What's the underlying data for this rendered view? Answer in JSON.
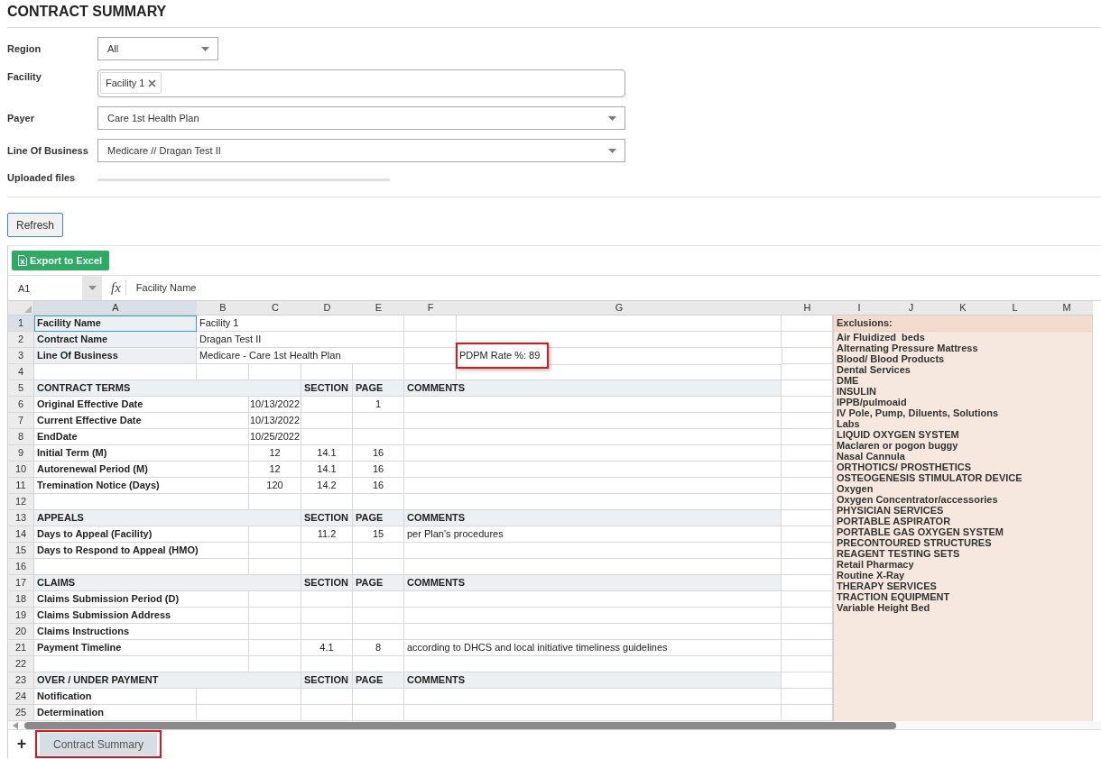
{
  "page_title": "CONTRACT SUMMARY",
  "filters": {
    "region": {
      "label": "Region",
      "value": "All"
    },
    "facility": {
      "label": "Facility",
      "chips": [
        {
          "label": "Facility 1"
        }
      ]
    },
    "payer": {
      "label": "Payer",
      "value": "Care 1st Health Plan"
    },
    "line_of_business": {
      "label": "Line Of Business",
      "value": "Medicare // Dragan Test II"
    },
    "uploaded_files": {
      "label": "Uploaded files"
    }
  },
  "refresh_button": "Refresh",
  "spreadsheet": {
    "export_button": "Export to Excel",
    "name_box": "A1",
    "function_label": "fx",
    "formula": "Facility Name",
    "columns": [
      {
        "label": "A",
        "selected": true
      },
      {
        "label": "B",
        "selected": false
      },
      {
        "label": "C",
        "selected": false
      },
      {
        "label": "D",
        "selected": false
      },
      {
        "label": "E",
        "selected": false
      },
      {
        "label": "F",
        "selected": false
      },
      {
        "label": "G",
        "selected": false
      },
      {
        "label": "H",
        "selected": false
      },
      {
        "label": "I",
        "selected": false
      },
      {
        "label": "J",
        "selected": false
      },
      {
        "label": "K",
        "selected": false
      },
      {
        "label": "L",
        "selected": false
      },
      {
        "label": "M",
        "selected": false
      }
    ],
    "rows": [
      {
        "number": "1",
        "selected": true,
        "kind": "info",
        "label": "Facility Name",
        "value": "Facility 1"
      },
      {
        "number": "2",
        "selected": false,
        "kind": "info",
        "label": "Contract Name",
        "value": "Dragan Test II"
      },
      {
        "number": "3",
        "selected": false,
        "kind": "info",
        "label": "Line Of Business",
        "value": "Medicare - Care 1st Health Plan",
        "note": "PDPM Rate %: 89",
        "note_highlighted": true
      },
      {
        "number": "4",
        "selected": false,
        "kind": "gap"
      },
      {
        "number": "5",
        "selected": false,
        "kind": "section",
        "title": "CONTRACT TERMS",
        "section": "SECTION",
        "page": "PAGE",
        "comments": "COMMENTS"
      },
      {
        "number": "6",
        "selected": false,
        "kind": "term",
        "label": "Original Effective Date",
        "value": "10/13/2022",
        "page": "1"
      },
      {
        "number": "7",
        "selected": false,
        "kind": "term",
        "label": "Current Effective Date",
        "value": "10/13/2022"
      },
      {
        "number": "8",
        "selected": false,
        "kind": "term",
        "label": "EndDate",
        "value": "10/25/2022"
      },
      {
        "number": "9",
        "selected": false,
        "kind": "term",
        "label": "Initial Term (M)",
        "value": "12",
        "section": "14.1",
        "page": "16"
      },
      {
        "number": "10",
        "selected": false,
        "kind": "term",
        "label": "Autorenewal Period (M)",
        "value": "12",
        "section": "14.1",
        "page": "16"
      },
      {
        "number": "11",
        "selected": false,
        "kind": "term",
        "label": "Tremination Notice (Days)",
        "value": "120",
        "section": "14.2",
        "page": "16"
      },
      {
        "number": "12",
        "selected": false,
        "kind": "term"
      },
      {
        "number": "13",
        "selected": false,
        "kind": "section",
        "title": "APPEALS",
        "section": "SECTION",
        "page": "PAGE",
        "comments": "COMMENTS"
      },
      {
        "number": "14",
        "selected": false,
        "kind": "term",
        "label": "Days to Appeal (Facility)",
        "section": "11.2",
        "page": "15",
        "comment": "per Plan's procedures"
      },
      {
        "number": "15",
        "selected": false,
        "kind": "term",
        "label": "Days to Respond to Appeal (HMO)"
      },
      {
        "number": "16",
        "selected": false,
        "kind": "term"
      },
      {
        "number": "17",
        "selected": false,
        "kind": "section",
        "title": "CLAIMS",
        "section": "SECTION",
        "page": "PAGE",
        "comments": "COMMENTS"
      },
      {
        "number": "18",
        "selected": false,
        "kind": "term",
        "label": "Claims Submission Period (D)"
      },
      {
        "number": "19",
        "selected": false,
        "kind": "term",
        "label": "Claims Submission Address"
      },
      {
        "number": "20",
        "selected": false,
        "kind": "term",
        "label": "Claims Instructions"
      },
      {
        "number": "21",
        "selected": false,
        "kind": "term",
        "label": "Payment Timeline",
        "section": "4.1",
        "page": "8",
        "comment": "according to DHCS and local initiative timeliness guidelines"
      },
      {
        "number": "22",
        "selected": false,
        "kind": "term"
      },
      {
        "number": "23",
        "selected": false,
        "kind": "section",
        "title": "OVER / UNDER PAYMENT",
        "section": "SECTION",
        "page": "PAGE",
        "comments": "COMMENTS"
      },
      {
        "number": "24",
        "selected": false,
        "kind": "split",
        "label": "Notification"
      },
      {
        "number": "25",
        "selected": false,
        "kind": "split",
        "label": "Determination"
      }
    ],
    "exclusions": {
      "title": "Exclusions:",
      "items": [
        "Air Fluidized  beds",
        "Alternating Pressure Mattress",
        "Blood/ Blood Products",
        "Dental Services",
        "DME",
        "INSULIN",
        "IPPB/pulmoaid",
        "IV Pole, Pump, Diluents, Solutions",
        "Labs",
        "LIQUID OXYGEN SYSTEM",
        "Maclaren or pogon buggy",
        "Nasal Cannula",
        "ORTHOTICS/ PROSTHETICS",
        "OSTEOGENESIS STIMULATOR DEVICE",
        "Oxygen",
        "Oxygen Concentrator/accessories",
        "PHYSICIAN SERVICES",
        "PORTABLE ASPIRATOR",
        "PORTABLE GAS OXYGEN SYSTEM",
        "PRECONTOURED STRUCTURES",
        "REAGENT TESTING SETS",
        "Retail Pharmacy",
        "Routine X-Ray",
        "THERAPY SERVICES",
        "TRACTION EQUIPMENT",
        "Variable Height Bed"
      ]
    },
    "add_sheet": "+",
    "sheet_tabs": [
      {
        "label": "Contract Summary",
        "selected": true,
        "highlighted": true
      }
    ]
  }
}
